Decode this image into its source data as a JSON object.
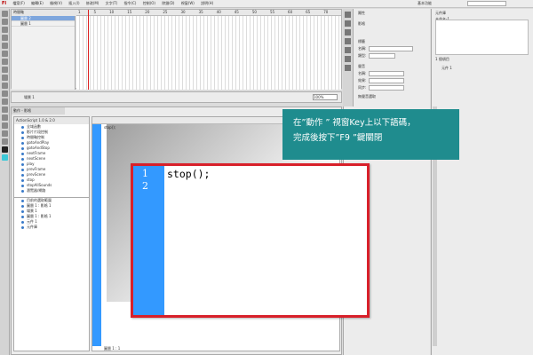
{
  "menu": {
    "logo": "Fl",
    "items": [
      "檔案(F)",
      "編輯(E)",
      "檢視(V)",
      "插入(I)",
      "修改(M)",
      "文字(T)",
      "指令(C)",
      "控制(O)",
      "除錯(D)",
      "視窗(W)",
      "說明(H)"
    ],
    "workspace": "基本功能"
  },
  "timeline": {
    "tab": "時間軸",
    "layers": [
      "圖層 2",
      "圖層 1"
    ],
    "ruler": [
      "1",
      "5",
      "10",
      "15",
      "20",
      "25",
      "30",
      "35",
      "40",
      "45",
      "50",
      "55",
      "60",
      "65",
      "70",
      "75"
    ]
  },
  "stage": {
    "scene": "場景 1",
    "zoom": "100%"
  },
  "actions": {
    "tab": "動作 - 影格",
    "version": "ActionScript 1.0 & 2.0",
    "list": [
      "全域函數",
      "影片片段控制",
      "時間軸控制",
      "gotoAndPlay",
      "gotoAndStop",
      "nextFrame",
      "nextScene",
      "play",
      "prevFrame",
      "prevScene",
      "stop",
      "stopAllSounds",
      "瀏覽器/網路"
    ],
    "tree": [
      "目前的選取範圍",
      "圖層 1 : 影格 1",
      "場景 1",
      "圖層 1 : 影格 1",
      "元件 1",
      "元件庫"
    ],
    "small_code": "stop();",
    "status": "圖層 1 : 1"
  },
  "properties": {
    "title": "屬性",
    "doc_label": "影格",
    "sections": [
      "標籤",
      "聲音"
    ],
    "fields": [
      "名稱:",
      "類型:",
      "名稱:",
      "效果:",
      "同步:",
      "無聲音選取"
    ]
  },
  "library": {
    "title": "元件庫",
    "doc": "未命名-1",
    "count": "1 個項目",
    "item": "元件 1"
  },
  "callout": {
    "line1": "在”動作 ” 視窗Key上以下語碼，",
    "line2": "完成後按下”F9 ”鍵關閉"
  },
  "zoom_editor": {
    "line_numbers": [
      "1",
      "2"
    ],
    "code": "stop();"
  },
  "colors": {
    "callout_bg": "#1f8c8e",
    "highlight_border": "#d8202a",
    "gutter": "#3399ff"
  }
}
